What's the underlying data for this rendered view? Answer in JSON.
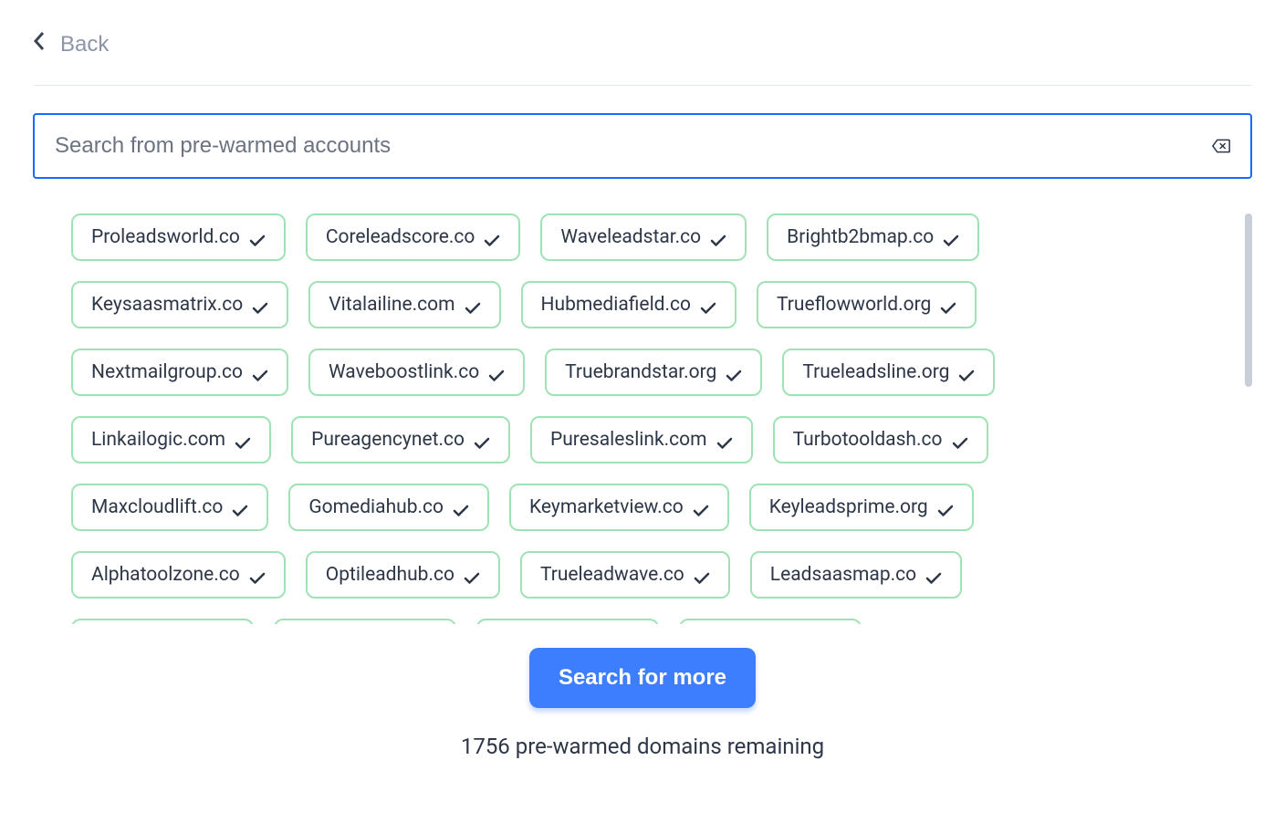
{
  "back_label": "Back",
  "search": {
    "placeholder": "Search from pre-warmed accounts",
    "value": ""
  },
  "domain_rows": [
    [
      "Proleadsworld.co",
      "Coreleadscore.co",
      "Waveleadstar.co",
      "Brightb2bmap.co"
    ],
    [
      "Keysaasmatrix.co",
      "Vitalailine.com",
      "Hubmediafield.co",
      "Trueflowworld.org"
    ],
    [
      "Nextmailgroup.co",
      "Waveboostlink.co",
      "Truebrandstar.org",
      "Trueleadsline.org"
    ],
    [
      "Linkailogic.com",
      "Pureagencynet.co",
      "Puresaleslink.com",
      "Turbotooldash.co"
    ],
    [
      "Maxcloudlift.co",
      "Gomediahub.co",
      "Keymarketview.co",
      "Keyleadsprime.org"
    ],
    [
      "Alphatoolzone.co",
      "Optileadhub.co",
      "Trueleadwave.co",
      "Leadsaasmap.co"
    ],
    [
      "",
      "",
      "",
      ""
    ]
  ],
  "search_more_label": "Search for more",
  "remaining_text": "1756 pre-warmed domains remaining"
}
